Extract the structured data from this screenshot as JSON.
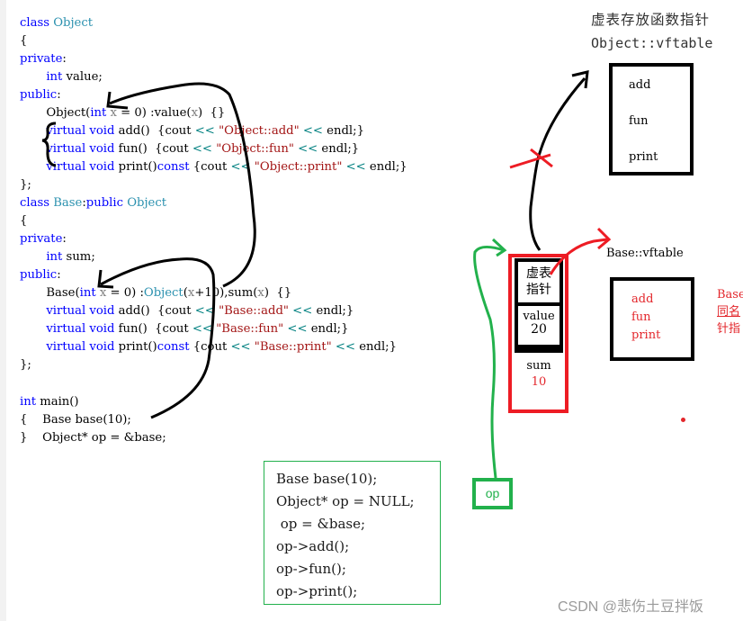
{
  "code": {
    "object_class": [
      [
        {
          "t": "class ",
          "c": "kw"
        },
        {
          "t": "Object",
          "c": "ty"
        }
      ],
      [
        {
          "t": "{",
          "c": ""
        }
      ],
      [
        {
          "t": "private",
          "c": "kw"
        },
        {
          "t": ":",
          "c": ""
        }
      ],
      [
        {
          "t": "       ",
          "c": ""
        },
        {
          "t": "int",
          "c": "kw"
        },
        {
          "t": " value;",
          "c": ""
        }
      ],
      [
        {
          "t": "public",
          "c": "kw"
        },
        {
          "t": ":",
          "c": ""
        }
      ],
      [
        {
          "t": "       Object(",
          "c": ""
        },
        {
          "t": "int",
          "c": "kw"
        },
        {
          "t": " ",
          "c": ""
        },
        {
          "t": "x",
          "c": "pm"
        },
        {
          "t": " = 0) :value(",
          "c": ""
        },
        {
          "t": "x",
          "c": "pm"
        },
        {
          "t": ")  {}",
          "c": ""
        }
      ],
      [
        {
          "t": "       ",
          "c": ""
        },
        {
          "t": "virtual void",
          "c": "kw"
        },
        {
          "t": " add()  {cout ",
          "c": ""
        },
        {
          "t": "<<",
          "c": "op"
        },
        {
          "t": " ",
          "c": ""
        },
        {
          "t": "\"Object::add\"",
          "c": "st"
        },
        {
          "t": " ",
          "c": ""
        },
        {
          "t": "<<",
          "c": "op"
        },
        {
          "t": " endl;}",
          "c": ""
        }
      ],
      [
        {
          "t": "       ",
          "c": ""
        },
        {
          "t": "virtual void",
          "c": "kw"
        },
        {
          "t": " fun()  {cout ",
          "c": ""
        },
        {
          "t": "<<",
          "c": "op"
        },
        {
          "t": " ",
          "c": ""
        },
        {
          "t": "\"Object::fun\"",
          "c": "st"
        },
        {
          "t": " ",
          "c": ""
        },
        {
          "t": "<<",
          "c": "op"
        },
        {
          "t": " endl;}",
          "c": ""
        }
      ],
      [
        {
          "t": "       ",
          "c": ""
        },
        {
          "t": "virtual void",
          "c": "kw"
        },
        {
          "t": " print()",
          "c": ""
        },
        {
          "t": "const",
          "c": "kw"
        },
        {
          "t": " {cout ",
          "c": ""
        },
        {
          "t": "<<",
          "c": "op"
        },
        {
          "t": " ",
          "c": ""
        },
        {
          "t": "\"Object::print\"",
          "c": "st"
        },
        {
          "t": " ",
          "c": ""
        },
        {
          "t": "<<",
          "c": "op"
        },
        {
          "t": " endl;}",
          "c": ""
        }
      ],
      [
        {
          "t": "};",
          "c": ""
        }
      ],
      [
        {
          "t": "class ",
          "c": "kw"
        },
        {
          "t": "Base",
          "c": "ty"
        },
        {
          "t": ":",
          "c": ""
        },
        {
          "t": "public",
          "c": "kw"
        },
        {
          "t": " ",
          "c": ""
        },
        {
          "t": "Object",
          "c": "ty"
        }
      ],
      [
        {
          "t": "{",
          "c": ""
        }
      ],
      [
        {
          "t": "private",
          "c": "kw"
        },
        {
          "t": ":",
          "c": ""
        }
      ],
      [
        {
          "t": "       ",
          "c": ""
        },
        {
          "t": "int",
          "c": "kw"
        },
        {
          "t": " sum;",
          "c": ""
        }
      ],
      [
        {
          "t": "public",
          "c": "kw"
        },
        {
          "t": ":",
          "c": ""
        }
      ],
      [
        {
          "t": "       Base(",
          "c": ""
        },
        {
          "t": "int",
          "c": "kw"
        },
        {
          "t": " ",
          "c": ""
        },
        {
          "t": "x",
          "c": "pm"
        },
        {
          "t": " = 0) :",
          "c": ""
        },
        {
          "t": "Object",
          "c": "ty"
        },
        {
          "t": "(",
          "c": ""
        },
        {
          "t": "x",
          "c": "pm"
        },
        {
          "t": "+10),sum(",
          "c": ""
        },
        {
          "t": "x",
          "c": "pm"
        },
        {
          "t": ")  {}",
          "c": ""
        }
      ],
      [
        {
          "t": "       ",
          "c": ""
        },
        {
          "t": "virtual void",
          "c": "kw"
        },
        {
          "t": " add()  {cout ",
          "c": ""
        },
        {
          "t": "<<",
          "c": "op"
        },
        {
          "t": " ",
          "c": ""
        },
        {
          "t": "\"Base::add\"",
          "c": "st"
        },
        {
          "t": " ",
          "c": ""
        },
        {
          "t": "<<",
          "c": "op"
        },
        {
          "t": " endl;}",
          "c": ""
        }
      ],
      [
        {
          "t": "       ",
          "c": ""
        },
        {
          "t": "virtual void",
          "c": "kw"
        },
        {
          "t": " fun()  {cout ",
          "c": ""
        },
        {
          "t": "<<",
          "c": "op"
        },
        {
          "t": " ",
          "c": ""
        },
        {
          "t": "\"Base::fun\"",
          "c": "st"
        },
        {
          "t": " ",
          "c": ""
        },
        {
          "t": "<<",
          "c": "op"
        },
        {
          "t": " endl;}",
          "c": ""
        }
      ],
      [
        {
          "t": "       ",
          "c": ""
        },
        {
          "t": "virtual void",
          "c": "kw"
        },
        {
          "t": " print()",
          "c": ""
        },
        {
          "t": "const",
          "c": "kw"
        },
        {
          "t": " {cout ",
          "c": ""
        },
        {
          "t": "<<",
          "c": "op"
        },
        {
          "t": " ",
          "c": ""
        },
        {
          "t": "\"Base::print\"",
          "c": "st"
        },
        {
          "t": " ",
          "c": ""
        },
        {
          "t": "<<",
          "c": "op"
        },
        {
          "t": " endl;}",
          "c": ""
        }
      ],
      [
        {
          "t": "};",
          "c": ""
        }
      ]
    ],
    "main": [
      [
        {
          "t": "int",
          "c": "kw"
        },
        {
          "t": " main()",
          "c": ""
        }
      ],
      [
        {
          "t": "{    Base base(10);",
          "c": ""
        }
      ],
      [
        {
          "t": "}    Object* op = &base;",
          "c": ""
        }
      ]
    ]
  },
  "note_box": {
    "lines": [
      "Base base(10);",
      "Object* op = NULL;",
      " op = &base;",
      "op->add();",
      "op->fun();",
      "op->print();"
    ]
  },
  "object_vftable": {
    "caption_cn": "虚表存放函数指针",
    "title": "Object::vftable",
    "entries": [
      "add",
      "fun",
      "print"
    ]
  },
  "base_vftable": {
    "title": "Base::vftable",
    "entries": [
      "add",
      "fun",
      "print"
    ],
    "side_note": [
      "Base",
      "同名",
      "针指"
    ]
  },
  "object_layout": {
    "vptr_label": [
      "虚表",
      "指针"
    ],
    "value_label": "value",
    "value": "20",
    "sum_label": "sum",
    "sum": "10"
  },
  "pointer": {
    "label": "op"
  },
  "colors": {
    "red": "#ed1c24",
    "green": "#22b14c",
    "keyword": "#0000ff",
    "type": "#2b91af",
    "string": "#a31515"
  },
  "watermark": "CSDN @悲伤土豆拌饭"
}
